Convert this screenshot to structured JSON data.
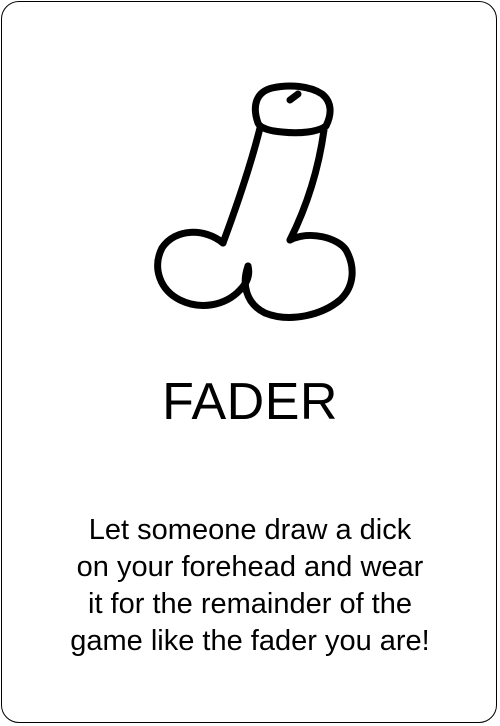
{
  "card": {
    "illustration_icon": "doodle-drawing-icon",
    "title": "FADER",
    "text_lines": [
      "Let someone draw a dick",
      "on your forehead and wear",
      "it for the remainder of the",
      "game like the fader you are!"
    ],
    "colors": {
      "ink": "#000000",
      "background": "#ffffff"
    }
  }
}
